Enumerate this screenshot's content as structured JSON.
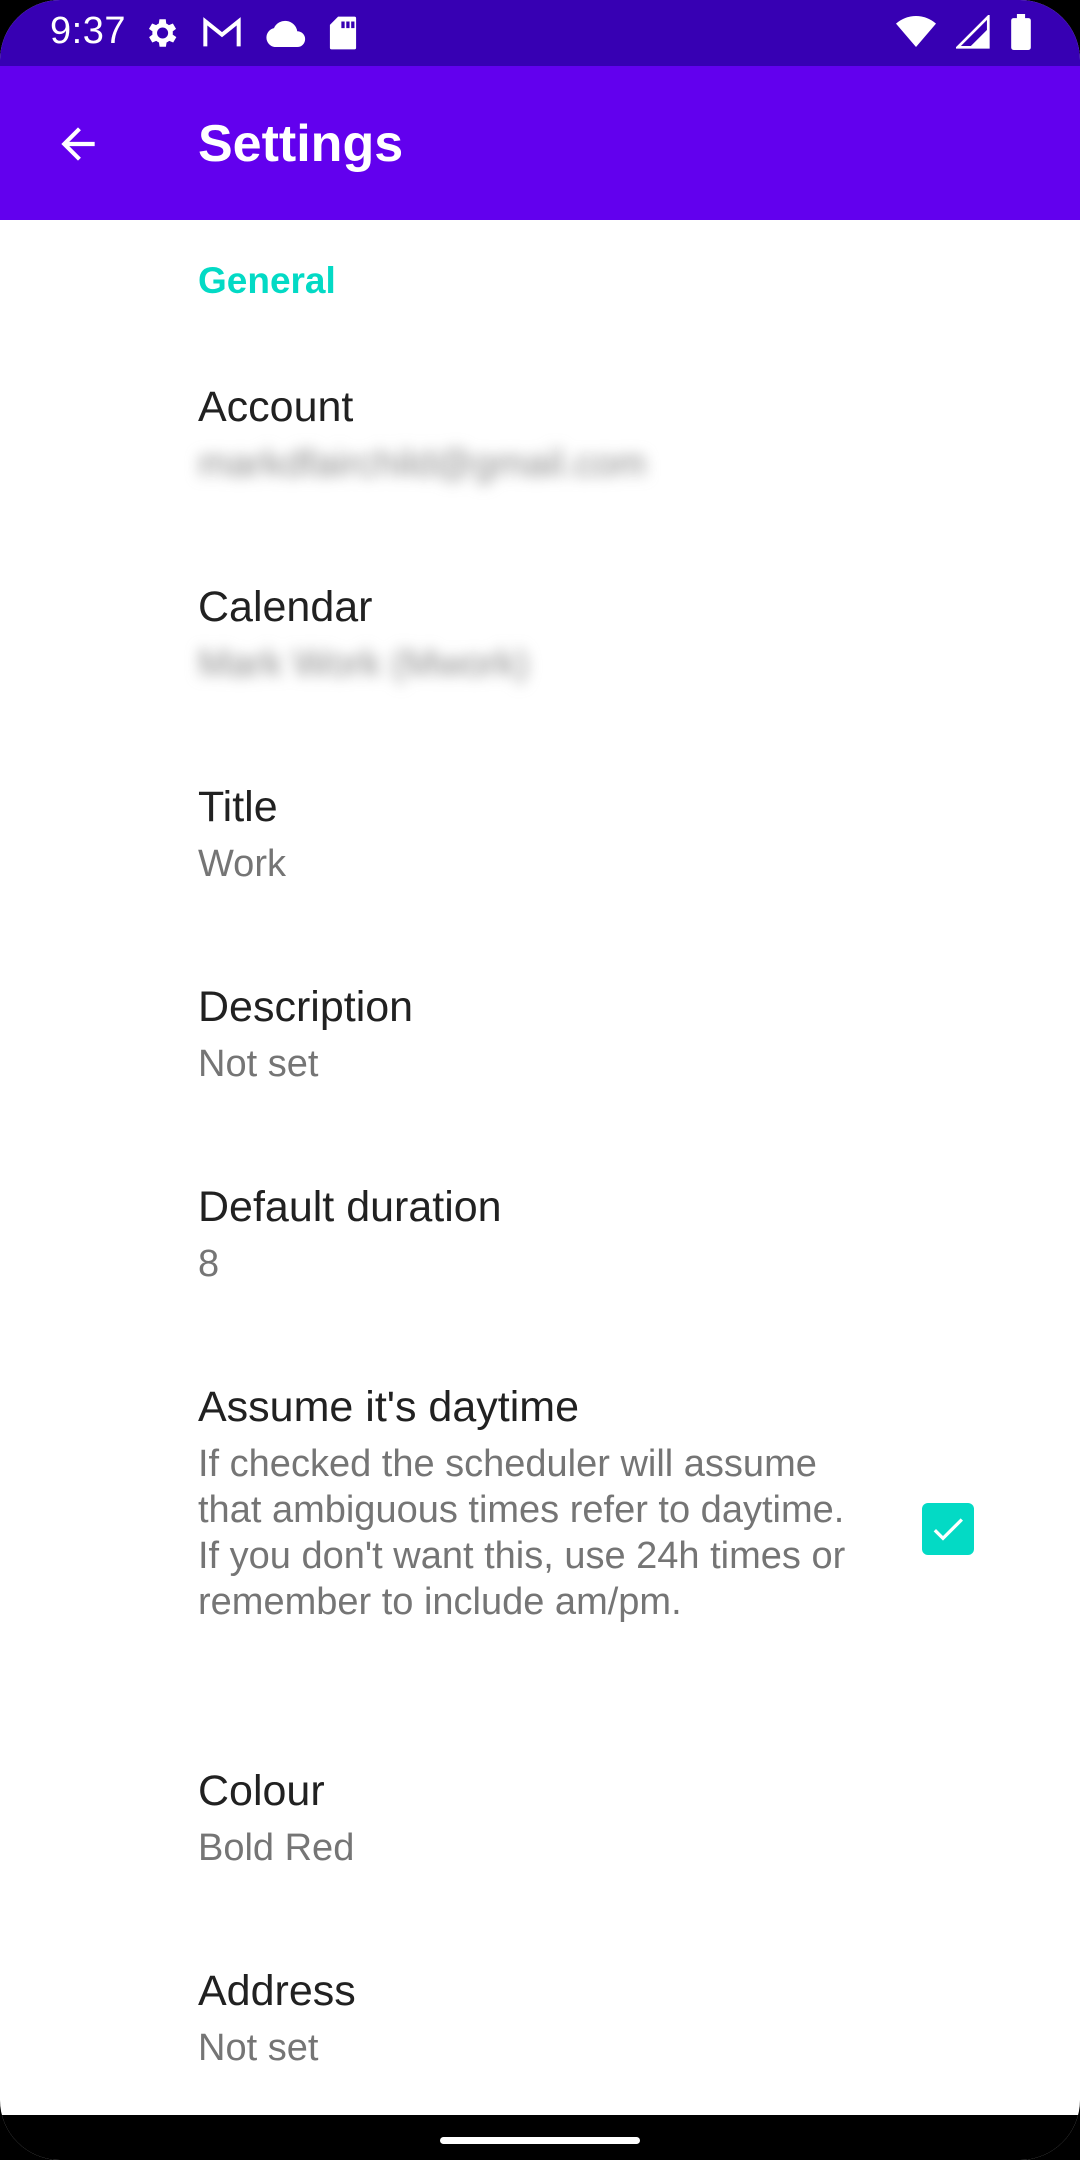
{
  "status_bar": {
    "time": "9:37",
    "left_icons": [
      "gear-icon",
      "gmail-icon",
      "cloud-icon",
      "sd-card-icon"
    ],
    "right_icons": [
      "wifi-icon",
      "cellular-signal-icon",
      "battery-icon"
    ]
  },
  "app_bar": {
    "title": "Settings",
    "back_icon": "arrow-back-icon",
    "color": "#6200ee"
  },
  "section": {
    "title": "General",
    "color": "#03dac5"
  },
  "preferences": {
    "account": {
      "title": "Account",
      "summary": "markdfairchild@gmail.com"
    },
    "calendar": {
      "title": "Calendar",
      "summary": "Mark Work (Mwork)"
    },
    "title": {
      "title": "Title",
      "summary": "Work"
    },
    "description": {
      "title": "Description",
      "summary": "Not set"
    },
    "duration": {
      "title": "Default duration",
      "summary": "8"
    },
    "daytime": {
      "title": "Assume it's daytime",
      "summary": "If checked the scheduler will assume that ambiguous times refer to daytime. If you don't want this, use 24h times or remember to include am/pm.",
      "checked": true
    },
    "colour": {
      "title": "Colour",
      "summary": "Bold Red"
    },
    "address": {
      "title": "Address",
      "summary": "Not set"
    }
  }
}
